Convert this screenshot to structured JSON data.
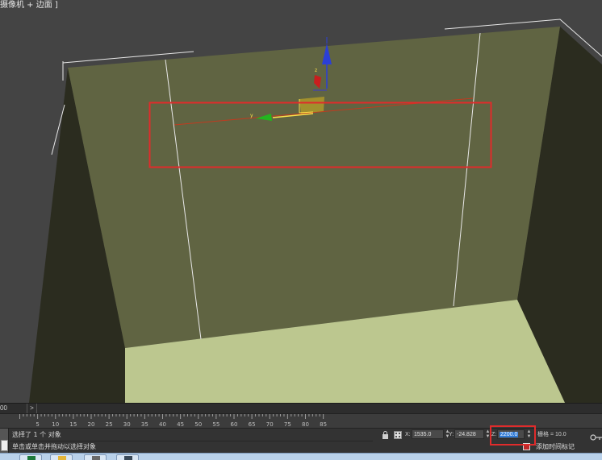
{
  "viewport": {
    "label": "摄像机 + 边面 ]",
    "gizmo": {
      "z_axis_label": "z",
      "y_axis_label": "y"
    }
  },
  "timebar": {
    "frame_field": "00",
    "next_button": ">"
  },
  "ruler": {
    "ticks": [
      "5",
      "10",
      "15",
      "20",
      "25",
      "30",
      "35",
      "40",
      "45",
      "50",
      "55",
      "60",
      "65",
      "70",
      "75",
      "80",
      "85"
    ]
  },
  "statusbar": {
    "selection_text": "选择了 1 个 对象",
    "prompt_text": "单击或单击并拖动以选择对象",
    "coords": {
      "x_label": "X:",
      "x_value": "1535.0",
      "y_label": "Y:",
      "y_value": "-24.828",
      "z_label": "Z:",
      "z_value": "2200.0"
    },
    "grid_text": "栅格 = 10.0",
    "add_time_tag": "添加时间标记"
  },
  "colors": {
    "wall": "#606442",
    "floor": "#bcc78f",
    "side_wall": "#2b2c1f",
    "highlight_box": "#e02b2b",
    "selection_blue": "#2f7ad6"
  }
}
